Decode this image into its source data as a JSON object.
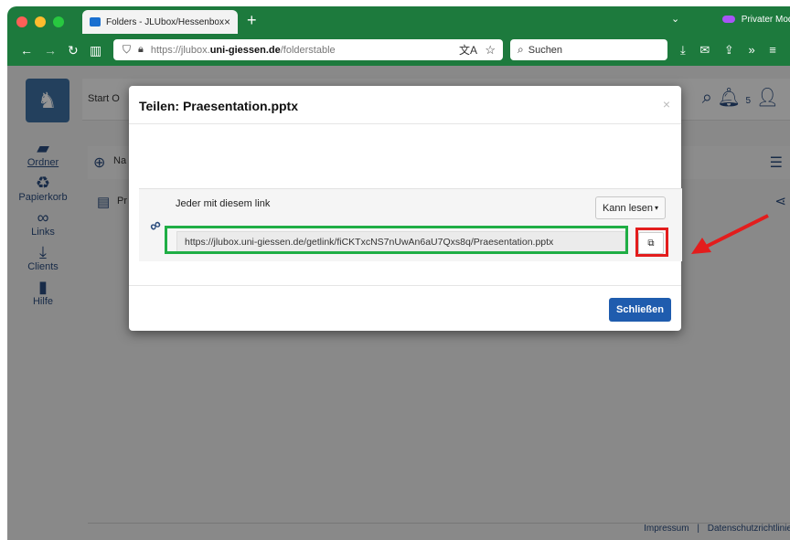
{
  "browser": {
    "tab_title": "Folders - JLUbox/Hessenbox",
    "tab_close": "×",
    "new_tab": "+",
    "private_label": "Privater Modus",
    "url_prefix": "https://jlubox.",
    "url_domain": "uni-giessen.de",
    "url_path": "/folderstable",
    "search_placeholder": "Suchen"
  },
  "app": {
    "nav_start": "Start O",
    "notification_count": "5",
    "sidebar": [
      {
        "label": "Ordner",
        "icon": "folder-icon"
      },
      {
        "label": "Papierkorb",
        "icon": "recycle-icon"
      },
      {
        "label": "Links",
        "icon": "link-icon"
      },
      {
        "label": "Clients",
        "icon": "download-icon"
      },
      {
        "label": "Hilfe",
        "icon": "book-icon"
      }
    ],
    "toolbar_new": "Na",
    "file_row_name": "Pr",
    "footer": {
      "impressum": "Impressum",
      "separator": "|",
      "datenschutz": "Datenschutzrichtlinie"
    }
  },
  "modal": {
    "title": "Teilen: Praesentation.pptx",
    "close_symbol": "×",
    "share_label": "Jeder mit diesem link",
    "permission_button": "Kann lesen",
    "link_url": "https://jlubox.uni-giessen.de/getlink/fiCKTxcNS7nUwAn6aU7Qxs8q/Praesentation.pptx",
    "close_button": "Schließen"
  },
  "colors": {
    "browser_chrome": "#1d7a3d",
    "highlight_green": "#1fae45",
    "highlight_red": "#e31d1d",
    "primary_button": "#1f5cae"
  }
}
